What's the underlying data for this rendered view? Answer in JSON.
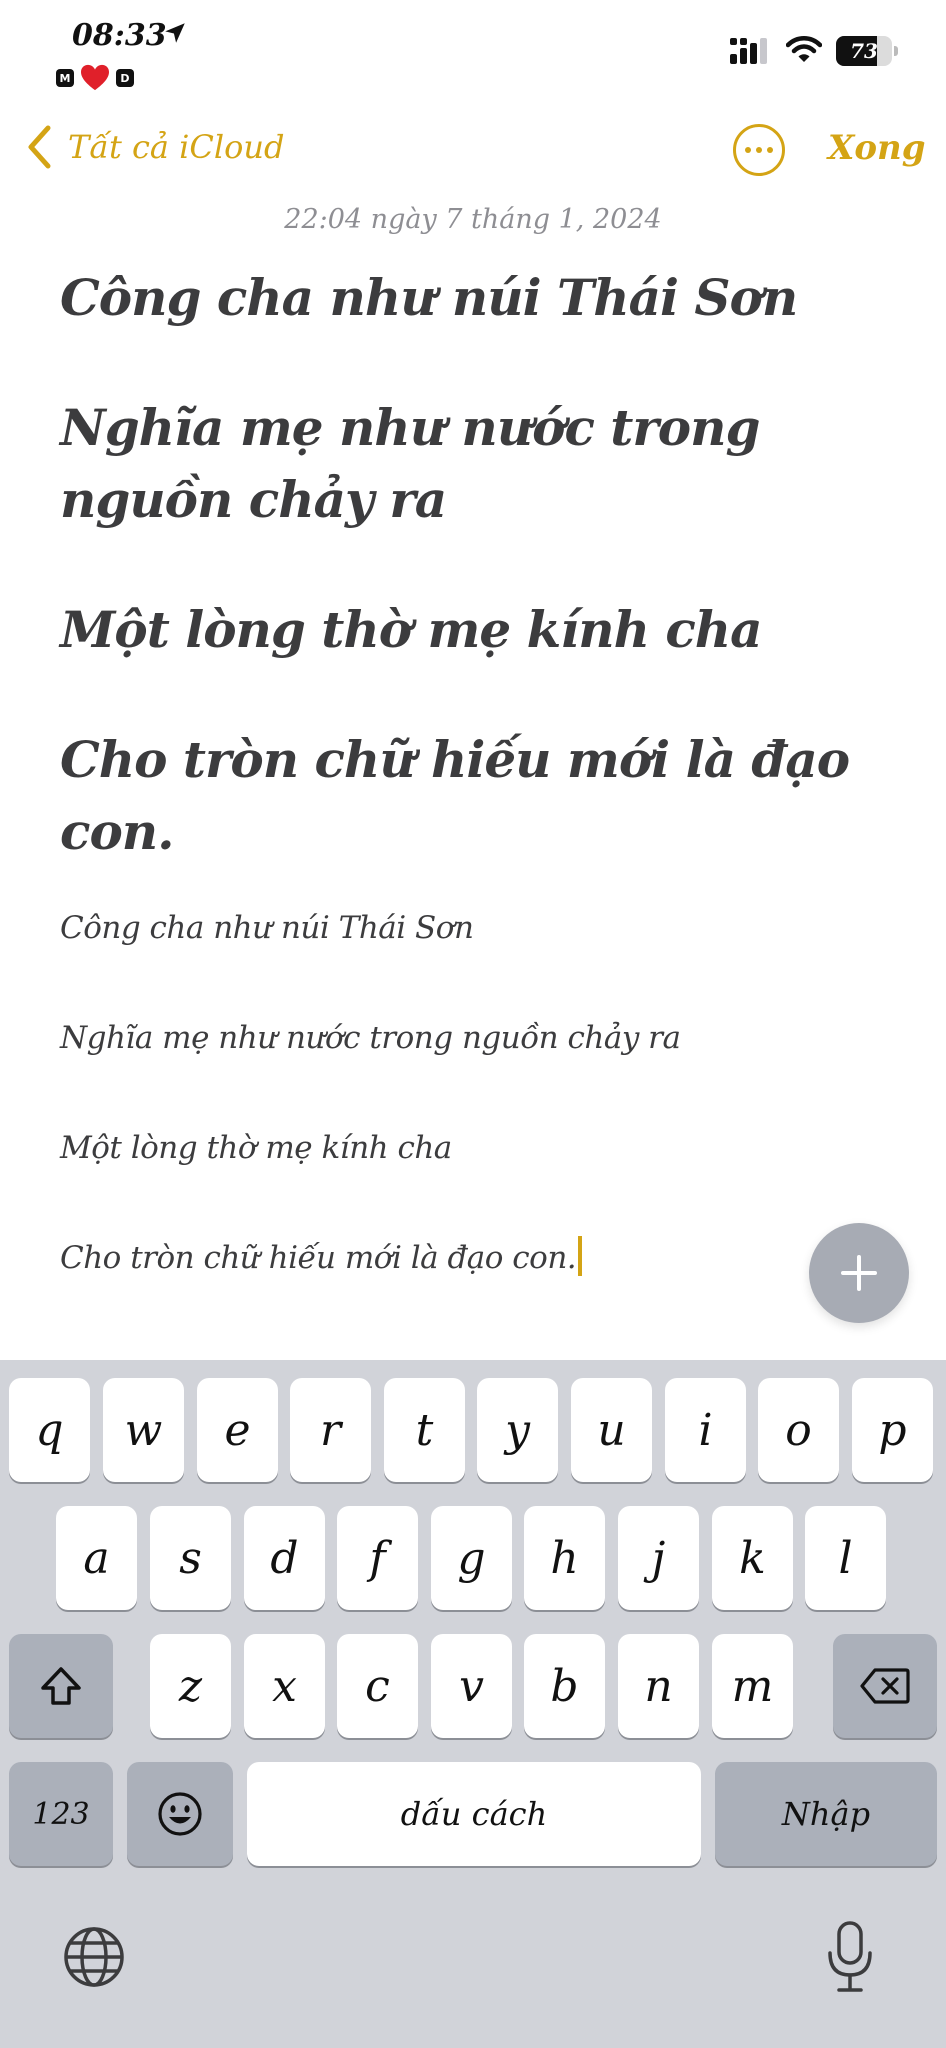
{
  "status_bar": {
    "time": "08:33",
    "focus_badges": [
      "M",
      "D"
    ],
    "battery_percent": "73",
    "battery_level": 0.73
  },
  "nav": {
    "back_label": "Tất cả iCloud",
    "done_label": "Xong",
    "accent_color": "#d4a415"
  },
  "note": {
    "date": "22:04 ngày 7 tháng 1, 2024",
    "heading_lines": [
      "Công cha như núi Thái Sơn",
      "Nghĩa mẹ như nước trong nguồn chảy ra",
      "Một lòng thờ mẹ kính cha",
      "Cho tròn chữ hiếu mới là đạo con."
    ],
    "body_lines": [
      "Công cha như núi Thái Sơn",
      "Nghĩa mẹ như nước trong nguồn chảy ra",
      "Một lòng thờ mẹ kính cha",
      "Cho tròn chữ hiếu mới là đạo con."
    ]
  },
  "keyboard": {
    "row1": [
      "q",
      "w",
      "e",
      "r",
      "t",
      "y",
      "u",
      "i",
      "o",
      "p"
    ],
    "row2": [
      "a",
      "s",
      "d",
      "f",
      "g",
      "h",
      "j",
      "k",
      "l"
    ],
    "row3": [
      "z",
      "x",
      "c",
      "v",
      "b",
      "n",
      "m"
    ],
    "numbers_label": "123",
    "space_label": "dấu cách",
    "return_label": "Nhập",
    "icons": [
      "shift-icon",
      "backspace-icon",
      "emoji-icon",
      "globe-icon",
      "microphone-icon"
    ]
  }
}
